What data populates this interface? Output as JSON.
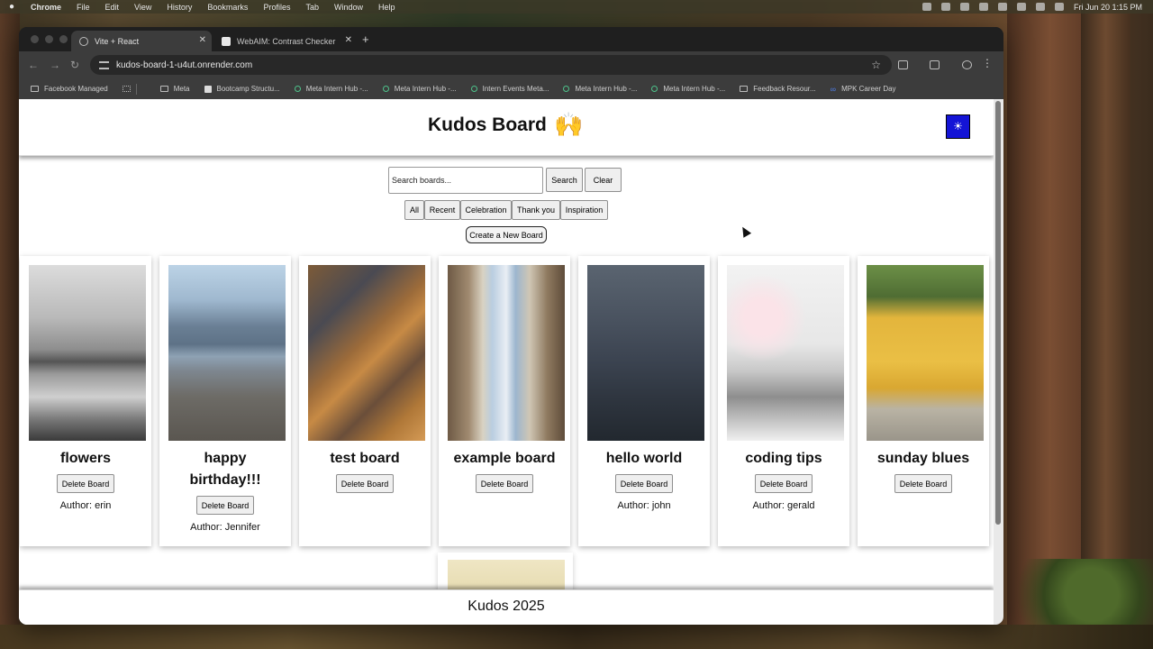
{
  "menubar": {
    "app": "Chrome",
    "items": [
      "File",
      "Edit",
      "View",
      "History",
      "Bookmarks",
      "Profiles",
      "Tab",
      "Window",
      "Help"
    ],
    "clock": "Fri Jun 20  1:15 PM"
  },
  "browser": {
    "tabs": [
      {
        "label": "Vite + React",
        "active": true
      },
      {
        "label": "WebAIM: Contrast Checker",
        "active": false
      }
    ],
    "url": "kudos-board-1-u4ut.onrender.com",
    "bookmarks": [
      "Facebook Managed",
      "Meta",
      "Bootcamp Structu...",
      "Meta Intern Hub -...",
      "Meta Intern Hub -...",
      "Intern Events Meta...",
      "Meta Intern Hub -...",
      "Meta Intern Hub -...",
      "Feedback Resour...",
      "MPK Career Day"
    ]
  },
  "page": {
    "title": "Kudos Board",
    "title_emoji": "🙌",
    "theme_toggle": "☀",
    "search": {
      "placeholder": "Search boards...",
      "value": ""
    },
    "search_button": "Search",
    "clear_button": "Clear",
    "filters": [
      "All",
      "Recent",
      "Celebration",
      "Thank you",
      "Inspiration"
    ],
    "create_button": "Create a New Board",
    "delete_label": "Delete Board",
    "boards": [
      {
        "title": "flowers",
        "author": "Author: erin"
      },
      {
        "title": "happy birthday!!!",
        "author": "Author: Jennifer"
      },
      {
        "title": "test board",
        "author": ""
      },
      {
        "title": "example board",
        "author": ""
      },
      {
        "title": "hello world",
        "author": "Author: john"
      },
      {
        "title": "coding tips",
        "author": "Author: gerald"
      },
      {
        "title": "sunday blues",
        "author": ""
      }
    ],
    "footer": "Kudos 2025"
  }
}
